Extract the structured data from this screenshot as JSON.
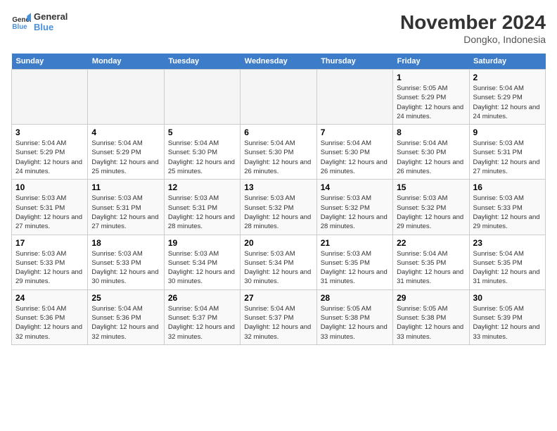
{
  "logo": {
    "line1": "General",
    "line2": "Blue"
  },
  "title": "November 2024",
  "subtitle": "Dongko, Indonesia",
  "weekdays": [
    "Sunday",
    "Monday",
    "Tuesday",
    "Wednesday",
    "Thursday",
    "Friday",
    "Saturday"
  ],
  "weeks": [
    [
      {
        "day": "",
        "info": ""
      },
      {
        "day": "",
        "info": ""
      },
      {
        "day": "",
        "info": ""
      },
      {
        "day": "",
        "info": ""
      },
      {
        "day": "",
        "info": ""
      },
      {
        "day": "1",
        "info": "Sunrise: 5:05 AM\nSunset: 5:29 PM\nDaylight: 12 hours and 24 minutes."
      },
      {
        "day": "2",
        "info": "Sunrise: 5:04 AM\nSunset: 5:29 PM\nDaylight: 12 hours and 24 minutes."
      }
    ],
    [
      {
        "day": "3",
        "info": "Sunrise: 5:04 AM\nSunset: 5:29 PM\nDaylight: 12 hours and 24 minutes."
      },
      {
        "day": "4",
        "info": "Sunrise: 5:04 AM\nSunset: 5:29 PM\nDaylight: 12 hours and 25 minutes."
      },
      {
        "day": "5",
        "info": "Sunrise: 5:04 AM\nSunset: 5:30 PM\nDaylight: 12 hours and 25 minutes."
      },
      {
        "day": "6",
        "info": "Sunrise: 5:04 AM\nSunset: 5:30 PM\nDaylight: 12 hours and 26 minutes."
      },
      {
        "day": "7",
        "info": "Sunrise: 5:04 AM\nSunset: 5:30 PM\nDaylight: 12 hours and 26 minutes."
      },
      {
        "day": "8",
        "info": "Sunrise: 5:04 AM\nSunset: 5:30 PM\nDaylight: 12 hours and 26 minutes."
      },
      {
        "day": "9",
        "info": "Sunrise: 5:03 AM\nSunset: 5:31 PM\nDaylight: 12 hours and 27 minutes."
      }
    ],
    [
      {
        "day": "10",
        "info": "Sunrise: 5:03 AM\nSunset: 5:31 PM\nDaylight: 12 hours and 27 minutes."
      },
      {
        "day": "11",
        "info": "Sunrise: 5:03 AM\nSunset: 5:31 PM\nDaylight: 12 hours and 27 minutes."
      },
      {
        "day": "12",
        "info": "Sunrise: 5:03 AM\nSunset: 5:31 PM\nDaylight: 12 hours and 28 minutes."
      },
      {
        "day": "13",
        "info": "Sunrise: 5:03 AM\nSunset: 5:32 PM\nDaylight: 12 hours and 28 minutes."
      },
      {
        "day": "14",
        "info": "Sunrise: 5:03 AM\nSunset: 5:32 PM\nDaylight: 12 hours and 28 minutes."
      },
      {
        "day": "15",
        "info": "Sunrise: 5:03 AM\nSunset: 5:32 PM\nDaylight: 12 hours and 29 minutes."
      },
      {
        "day": "16",
        "info": "Sunrise: 5:03 AM\nSunset: 5:33 PM\nDaylight: 12 hours and 29 minutes."
      }
    ],
    [
      {
        "day": "17",
        "info": "Sunrise: 5:03 AM\nSunset: 5:33 PM\nDaylight: 12 hours and 29 minutes."
      },
      {
        "day": "18",
        "info": "Sunrise: 5:03 AM\nSunset: 5:33 PM\nDaylight: 12 hours and 30 minutes."
      },
      {
        "day": "19",
        "info": "Sunrise: 5:03 AM\nSunset: 5:34 PM\nDaylight: 12 hours and 30 minutes."
      },
      {
        "day": "20",
        "info": "Sunrise: 5:03 AM\nSunset: 5:34 PM\nDaylight: 12 hours and 30 minutes."
      },
      {
        "day": "21",
        "info": "Sunrise: 5:03 AM\nSunset: 5:35 PM\nDaylight: 12 hours and 31 minutes."
      },
      {
        "day": "22",
        "info": "Sunrise: 5:04 AM\nSunset: 5:35 PM\nDaylight: 12 hours and 31 minutes."
      },
      {
        "day": "23",
        "info": "Sunrise: 5:04 AM\nSunset: 5:35 PM\nDaylight: 12 hours and 31 minutes."
      }
    ],
    [
      {
        "day": "24",
        "info": "Sunrise: 5:04 AM\nSunset: 5:36 PM\nDaylight: 12 hours and 32 minutes."
      },
      {
        "day": "25",
        "info": "Sunrise: 5:04 AM\nSunset: 5:36 PM\nDaylight: 12 hours and 32 minutes."
      },
      {
        "day": "26",
        "info": "Sunrise: 5:04 AM\nSunset: 5:37 PM\nDaylight: 12 hours and 32 minutes."
      },
      {
        "day": "27",
        "info": "Sunrise: 5:04 AM\nSunset: 5:37 PM\nDaylight: 12 hours and 32 minutes."
      },
      {
        "day": "28",
        "info": "Sunrise: 5:05 AM\nSunset: 5:38 PM\nDaylight: 12 hours and 33 minutes."
      },
      {
        "day": "29",
        "info": "Sunrise: 5:05 AM\nSunset: 5:38 PM\nDaylight: 12 hours and 33 minutes."
      },
      {
        "day": "30",
        "info": "Sunrise: 5:05 AM\nSunset: 5:39 PM\nDaylight: 12 hours and 33 minutes."
      }
    ]
  ]
}
